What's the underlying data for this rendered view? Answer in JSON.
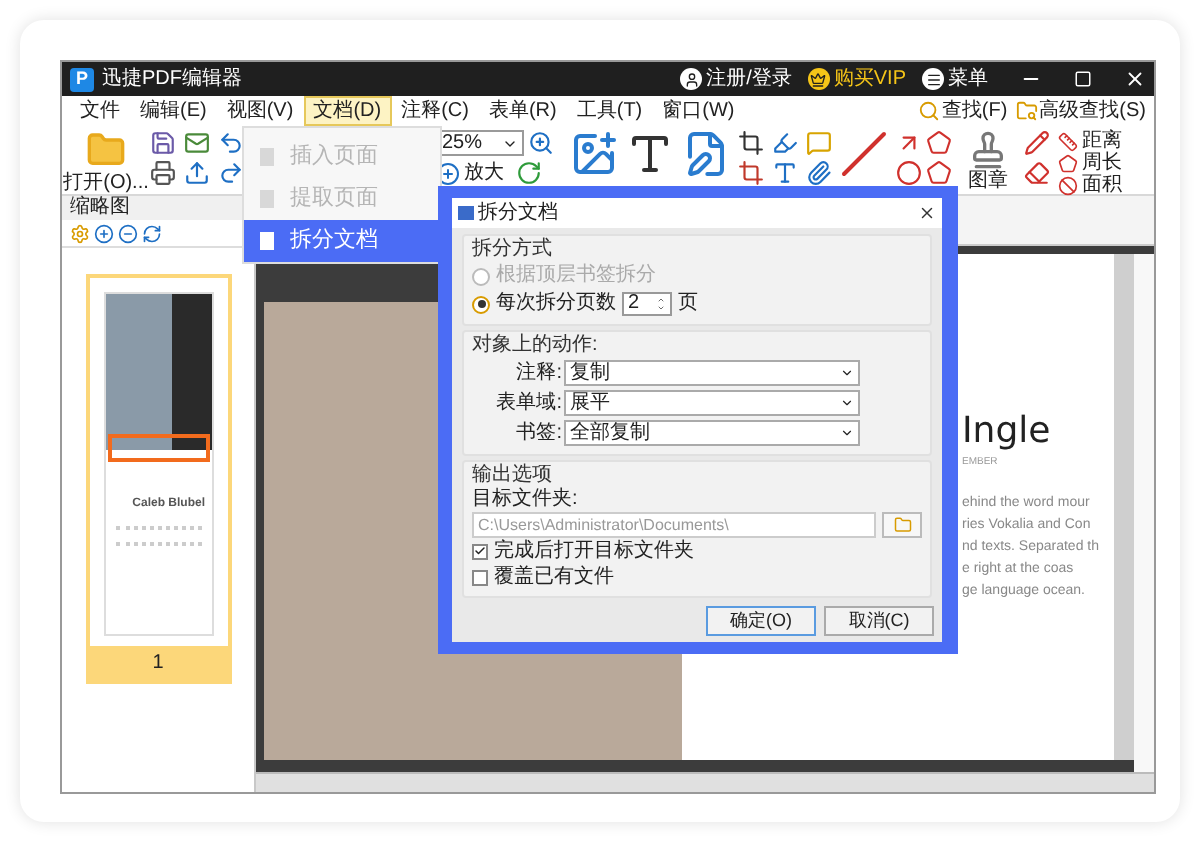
{
  "window": {
    "logo_letter": "P",
    "title": "迅捷PDF编辑器",
    "account_links": [
      {
        "label": "注册/登录",
        "kind": "user"
      },
      {
        "label": "购买VIP",
        "kind": "vip"
      },
      {
        "label": "菜单",
        "kind": "menu"
      }
    ]
  },
  "menu_bar": {
    "items": [
      {
        "label": "文件",
        "selected": false
      },
      {
        "label": "编辑(E)",
        "selected": false
      },
      {
        "label": "视图(V)",
        "selected": false
      },
      {
        "label": "文档(D)",
        "selected": true
      },
      {
        "label": "注释(C)",
        "selected": false
      },
      {
        "label": "表单(R)",
        "selected": false
      },
      {
        "label": "工具(T)",
        "selected": false
      },
      {
        "label": "窗口(W)",
        "selected": false
      }
    ],
    "find_buttons": [
      {
        "label": "查找(F)",
        "kind": "find"
      },
      {
        "label": "高级查找(S)",
        "kind": "advanced"
      }
    ]
  },
  "dropdown_menu": {
    "items": [
      {
        "label": "插入页面",
        "disabled": true,
        "selected": false
      },
      {
        "label": "提取页面",
        "disabled": true,
        "selected": false
      },
      {
        "label": "拆分文档",
        "disabled": false,
        "selected": true
      }
    ]
  },
  "toolbar": {
    "open_label": "打开(O)...",
    "zoom_value": "25%",
    "zoom_in_label": "放大",
    "stamp_label": "图章",
    "measure_tools": [
      {
        "label": "距离",
        "kind": "distance"
      },
      {
        "label": "周长",
        "kind": "perimeter"
      },
      {
        "label": "面积",
        "kind": "area"
      }
    ]
  },
  "thumbnail_panel": {
    "title": "缩略图",
    "pages": [
      {
        "name": "Caleb Blubel",
        "number": "1",
        "selected": true
      }
    ]
  },
  "document": {
    "heading": "Ingle",
    "subheading": "EMBER",
    "body_lines": [
      "ehind the word mour",
      "ries Vokalia and Con",
      "nd texts. Separated th",
      "e right at the coas",
      "ge language ocean."
    ]
  },
  "dialog": {
    "title": "拆分文档",
    "split_group": {
      "title": "拆分方式",
      "options": [
        {
          "label": "根据顶层书签拆分",
          "selected": false,
          "disabled": true
        },
        {
          "label": "每次拆分页数",
          "selected": true,
          "disabled": false
        }
      ],
      "pages_value": "2",
      "pages_unit": "页"
    },
    "actions_group": {
      "title": "对象上的动作:",
      "fields": [
        {
          "label": "注释:",
          "value": "复制"
        },
        {
          "label": "表单域:",
          "value": "展平"
        },
        {
          "label": "书签:",
          "value": "全部复制"
        }
      ]
    },
    "output_group": {
      "title": "输出选项",
      "folder_label": "目标文件夹:",
      "folder_path": "C:\\Users\\Administrator\\Documents\\",
      "checkboxes": [
        {
          "label": "完成后打开目标文件夹",
          "checked": true
        },
        {
          "label": "覆盖已有文件",
          "checked": false
        }
      ]
    },
    "buttons": [
      {
        "label": "确定(O)",
        "focused": true
      },
      {
        "label": "取消(C)",
        "focused": false
      }
    ]
  }
}
